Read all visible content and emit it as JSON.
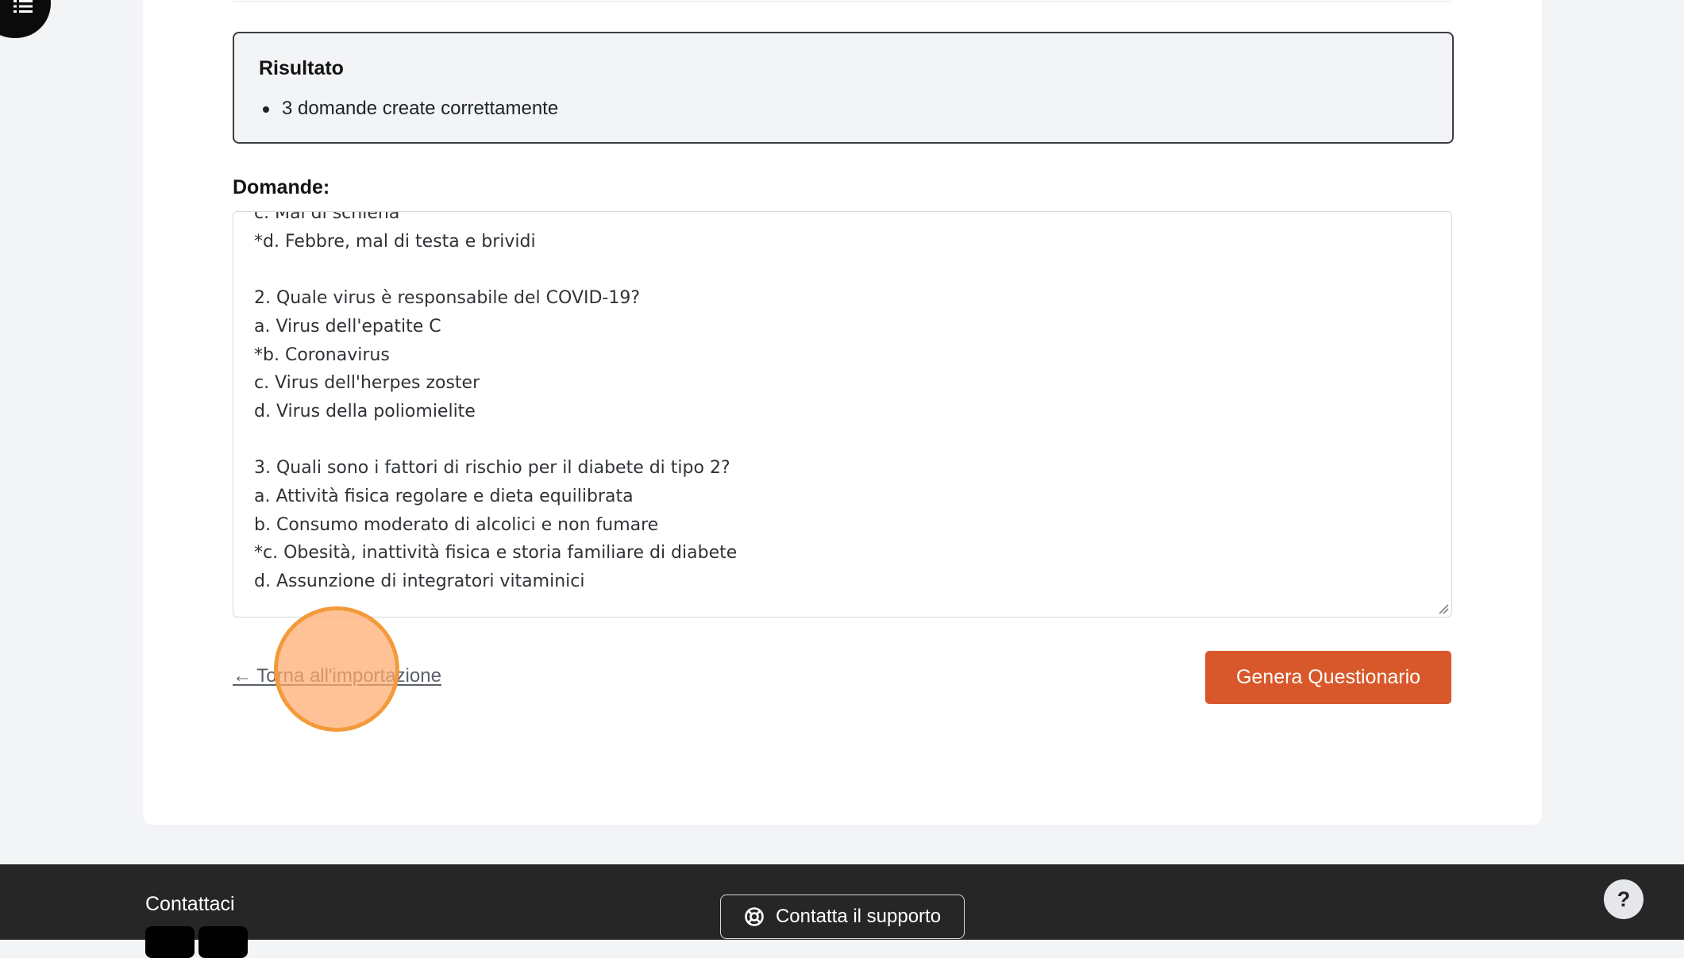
{
  "nav": {
    "menu_icon": "list-icon"
  },
  "result": {
    "title": "Risultato",
    "items": [
      "3 domande create correttamente"
    ]
  },
  "questions_field": {
    "label": "Domande:",
    "value": "c. Mal di schiena\n*d. Febbre, mal di testa e brividi\n\n2. Quale virus è responsabile del COVID-19?\na. Virus dell'epatite C\n*b. Coronavirus\nc. Virus dell'herpes zoster\nd. Virus della poliomielite\n\n3. Quali sono i fattori di rischio per il diabete di tipo 2?\na. Attività fisica regolare e dieta equilibrata\nb. Consumo moderato di alcolici e non fumare\n*c. Obesità, inattività fisica e storia familiare di diabete\nd. Assunzione di integratori vitaminici"
  },
  "actions": {
    "back_link": "← Torna all'importazione",
    "generate_button": "Genera Questionario"
  },
  "footer": {
    "contact_heading": "Contattaci",
    "support_button": "Contatta il supporto",
    "support_icon": "lifebuoy-icon"
  },
  "help": {
    "label": "?"
  },
  "colors": {
    "primary": "#d9582b",
    "footer_bg": "#262626",
    "page_bg": "#f3f4f6",
    "click_marker": "#f39a3b"
  }
}
